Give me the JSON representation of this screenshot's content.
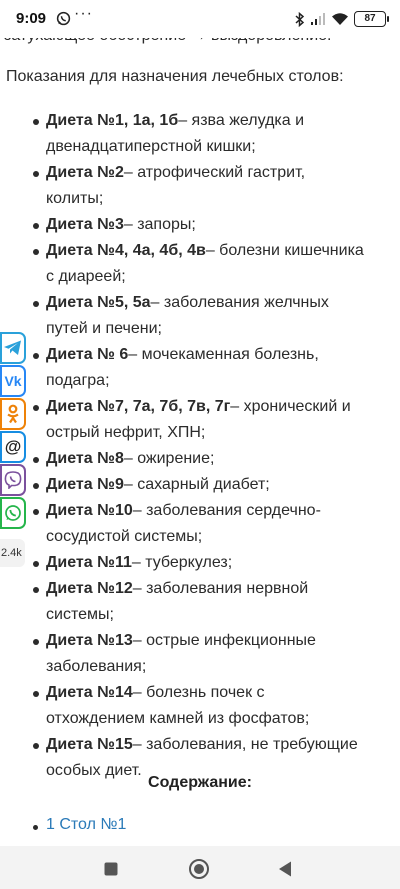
{
  "status_bar": {
    "time": "9:09",
    "notification_icon": "whatsapp-icon",
    "more": "···",
    "icons": [
      "bluetooth-icon",
      "signal-icon",
      "wifi-icon"
    ],
    "battery": "87"
  },
  "article": {
    "top_line": "затухающее обострение → выздоровление.",
    "intro": "Показания для назначения лечебных столов:",
    "diets": [
      {
        "name": "Диета №1, 1а, 1б",
        "text": "– язва желудка и двенадцатиперстной кишки;"
      },
      {
        "name": "Диета №2",
        "text": "– атрофический гастрит, колиты;"
      },
      {
        "name": "Диета №3",
        "text": "– запоры;"
      },
      {
        "name": "Диета №4, 4а, 4б, 4в",
        "text": "– болезни кишечника с диареей;"
      },
      {
        "name": "Диета №5, 5а",
        "text": "– заболевания желчных путей и печени;"
      },
      {
        "name": "Диета № 6",
        "text": "– мочекаменная болезнь, подагра;"
      },
      {
        "name": "Диета №7, 7а, 7б, 7в, 7г",
        "text": "– хронический и острый нефрит, ХПН;"
      },
      {
        "name": "Диета №8",
        "text": "– ожирение;"
      },
      {
        "name": "Диета №9",
        "text": "– сахарный диабет;"
      },
      {
        "name": "Диета №10",
        "text": "– заболевания сердечно-сосудистой системы;"
      },
      {
        "name": "Диета №11",
        "text": "– туберкулез;"
      },
      {
        "name": "Диета №12",
        "text": "– заболевания нервной системы;"
      },
      {
        "name": "Диета №13",
        "text": "– острые инфекционные заболевания;"
      },
      {
        "name": "Диета №14",
        "text": "– болезнь почек с отхождением камней из фосфатов;"
      },
      {
        "name": "Диета №15",
        "text": "– заболевания, не требующие особых диет."
      }
    ],
    "toc_title": "Содержание:",
    "toc_first": "1 Стол №1"
  },
  "share": {
    "buttons": [
      {
        "icon": "telegram-icon",
        "color": "#2aa1da",
        "glyph": ""
      },
      {
        "icon": "vk-icon",
        "color": "#2787f5",
        "glyph": "Vk"
      },
      {
        "icon": "odnoklassniki-icon",
        "color": "#ee8208",
        "glyph": "ok"
      },
      {
        "icon": "mail-icon",
        "color": "#168de2",
        "glyph": "@"
      },
      {
        "icon": "viber-icon",
        "color": "#7b519d",
        "glyph": ""
      },
      {
        "icon": "whatsapp-icon",
        "color": "#25b54b",
        "glyph": ""
      }
    ],
    "count": "2.4k"
  },
  "nav": [
    "recent-apps-icon",
    "home-icon",
    "back-icon"
  ],
  "colors": {
    "text": "#2b2b2b",
    "link": "#2a7ab8"
  }
}
